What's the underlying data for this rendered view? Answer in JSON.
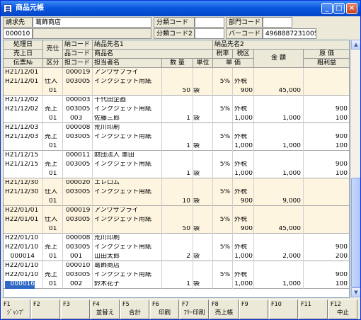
{
  "window": {
    "title": "商品元帳"
  },
  "header": {
    "billing_label": "請求先",
    "billing_name": "葛飾商店",
    "billing_code": "000010",
    "class_code_label": "分類コード",
    "class_code2_label": "分類コード2",
    "dept_code_label": "部門コード",
    "barcode_label": "バーコード",
    "barcode_value": "4968887231005"
  },
  "columns": {
    "proc_date": "処理日",
    "sale_date": "売上日",
    "slip_no": "伝票№",
    "sale_buy": "売仕",
    "kubun": "区分",
    "deliv_code": "納コード",
    "item_code": "品コード",
    "rep_code": "担コード",
    "deliv_name1": "納品先名1",
    "item_name": "商品名",
    "rep_name": "担当者名",
    "deliv_name2": "納品先名2",
    "qty": "数 量",
    "unit": "単位",
    "tax_rate": "税率",
    "tax_kubun": "税区",
    "unit_price": "単 価",
    "amount": "金 額",
    "cost": "原 価",
    "gross_profit": "粗利益"
  },
  "rows": [
    {
      "d1": "H21/12/01",
      "d2": "H21/12/01",
      "slip": "",
      "type": "仕入",
      "kubun": "01",
      "dc": "000019",
      "ic": "003005",
      "rc": "",
      "n1": "アンワサプライ",
      "n2": "インクジェット用紙",
      "n3": "",
      "qty": "50",
      "unit": "袋",
      "rate": "5%",
      "tax": "外税",
      "price": "900",
      "amount": "45,000",
      "cost": "",
      "profit": "",
      "bg": "#fdf5e0"
    },
    {
      "d1": "H21/12/02",
      "d2": "H21/12/02",
      "slip": "",
      "type": "売上",
      "kubun": "01",
      "dc": "000003",
      "ic": "003005",
      "rc": "003",
      "n1": "千代田企画",
      "n2": "インクジェット用紙",
      "n3": "佐藤三郎",
      "qty": "1",
      "unit": "袋",
      "rate": "5%",
      "tax": "外税",
      "price": "1,000",
      "amount": "1,000",
      "cost": "900",
      "profit": "100",
      "bg": "#ffffff"
    },
    {
      "d1": "H21/12/03",
      "d2": "H21/12/03",
      "slip": "",
      "type": "売上",
      "kubun": "01",
      "dc": "000008",
      "ic": "003005",
      "rc": "",
      "n1": "荒川印刷",
      "n2": "インクジェット用紙",
      "n3": "",
      "qty": "1",
      "unit": "袋",
      "rate": "5%",
      "tax": "外税",
      "price": "1,000",
      "amount": "1,000",
      "cost": "900",
      "profit": "100",
      "bg": "#ffffff"
    },
    {
      "d1": "H21/12/15",
      "d2": "H21/12/15",
      "slip": "",
      "type": "売上",
      "kubun": "01",
      "dc": "000011",
      "ic": "003005",
      "rc": "",
      "n1": "財団法人 墨田",
      "n2": "インクジェット用紙",
      "n3": "",
      "qty": "1",
      "unit": "袋",
      "rate": "5%",
      "tax": "外税",
      "price": "1,000",
      "amount": "1,000",
      "cost": "900",
      "profit": "100",
      "bg": "#ffffff"
    },
    {
      "d1": "H21/12/30",
      "d2": "H21/12/30",
      "slip": "",
      "type": "仕入",
      "kubun": "01",
      "dc": "000020",
      "ic": "003005",
      "rc": "",
      "n1": "エレロム",
      "n2": "インクジェット用紙",
      "n3": "",
      "qty": "10",
      "unit": "袋",
      "rate": "5%",
      "tax": "外税",
      "price": "900",
      "amount": "9,000",
      "cost": "",
      "profit": "",
      "bg": "#fdf5e0"
    },
    {
      "d1": "H22/01/01",
      "d2": "H22/01/01",
      "slip": "",
      "type": "仕入",
      "kubun": "01",
      "dc": "000019",
      "ic": "003005",
      "rc": "",
      "n1": "アンワサプライ",
      "n2": "インクジェット用紙",
      "n3": "",
      "qty": "50",
      "unit": "袋",
      "rate": "5%",
      "tax": "外税",
      "price": "900",
      "amount": "45,000",
      "cost": "",
      "profit": "",
      "bg": "#fdf5e0"
    },
    {
      "d1": "H22/01/10",
      "d2": "H22/01/10",
      "slip": "000014",
      "type": "売上",
      "kubun": "01",
      "dc": "000008",
      "ic": "003005",
      "rc": "001",
      "n1": "荒川印刷",
      "n2": "インクジェット用紙",
      "n3": "山田太郎",
      "qty": "2",
      "unit": "袋",
      "rate": "5%",
      "tax": "外税",
      "price": "1,000",
      "amount": "2,000",
      "cost": "900",
      "profit": "200",
      "bg": "#ffffff"
    },
    {
      "d1": "H22/01/10",
      "d2": "H22/01/10",
      "slip": "000016",
      "type": "売上",
      "kubun": "01",
      "dc": "000010",
      "ic": "003005",
      "rc": "002",
      "n1": "葛飾商店",
      "n2": "インクジェット用紙",
      "n3": "鈴木花子",
      "qty": "1",
      "unit": "袋",
      "rate": "5%",
      "tax": "外税",
      "price": "1,000",
      "amount": "1,000",
      "cost": "900",
      "profit": "100",
      "bg": "#ffffff"
    }
  ],
  "fkeys": [
    {
      "key": "F1",
      "label": "ｼﾞｬﾝﾌﾟ"
    },
    {
      "key": "F2",
      "label": ""
    },
    {
      "key": "F3",
      "label": ""
    },
    {
      "key": "F4",
      "label": "並替え"
    },
    {
      "key": "F5",
      "label": "合計"
    },
    {
      "key": "F6",
      "label": "印刷"
    },
    {
      "key": "F7",
      "label": "ﾌﾘｰ印刷"
    },
    {
      "key": "F8",
      "label": "売上帳"
    },
    {
      "key": "F9",
      "label": ""
    },
    {
      "key": "F10",
      "label": ""
    },
    {
      "key": "F11",
      "label": ""
    },
    {
      "key": "F12",
      "label": "中止"
    }
  ]
}
